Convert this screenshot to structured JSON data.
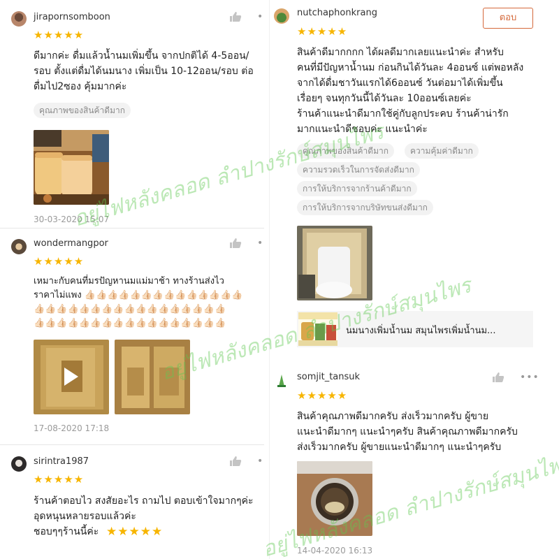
{
  "left_reviews": [
    {
      "username": "jirapornsomboon",
      "stars": "★★★★★",
      "text": "ดีมากค่ะ ดื่มแล้วน้ำนมเพิ่มขึ้น จากปกติได้ 4-5ออน/\nรอบ ตั้งแต่ดื่มได้นมนาง เพิ่มเป็น 10-12ออน/รอบ ต่อ\nดื่มไป2ซอง คุ้มมากค่ะ",
      "tags": [
        "คุณภาพของสินค้าดีมาก"
      ],
      "date": "30-03-2020 15:07"
    },
    {
      "username": "wondermangpor",
      "stars": "★★★★★",
      "text": "เหมาะกับคนที่มรปัญหานมแม่มาช้า ทางร้านส่งไว\nราคาไม่แพง 👍🏻👍🏻👍🏻👍🏻👍🏻👍🏻👍🏻👍🏻👍🏻👍🏻👍🏻👍🏻👍🏻👍🏻\n👍🏻👍🏻👍🏻👍🏻👍🏻👍🏻👍🏻👍🏻👍🏻👍🏻👍🏻👍🏻👍🏻👍🏻👍🏻👍🏻👍🏻\n👍🏻👍🏻👍🏻👍🏻👍🏻👍🏻👍🏻👍🏻👍🏻👍🏻👍🏻👍🏻👍🏻👍🏻👍🏻👍🏻👍🏻",
      "date": "17-08-2020 17:18"
    },
    {
      "username": "sirintra1987",
      "stars": "★★★★★",
      "text": "ร้านค้าตอบไว สงสัยอะไร ถามไป ตอบเข้าใจมากๆค่ะ\nอุดหนุนหลายรอบแล้วค่ะ\nชอบๆๆร้านนี้ค่ะ",
      "inline_stars": "★★★★★"
    }
  ],
  "right_reviews": [
    {
      "username": "nutchaphonkrang",
      "reply_label": "ตอบ",
      "stars": "★★★★★",
      "text": "สินค้าดีมากกกก ได้ผลดีมากเลยแนะนำค่ะ สำหรับ\nคนที่มีปัญหาน้ำนม ก่อนกินได้วันละ 4ออนซ์ แต่พอหลัง\nจากได้ดื่มชาวันแรกได้6ออนซ์ วันต่อมาได้เพิ่มขึ้น\nเรื่อยๆ จนทุกวันนี้ได้วันละ 10ออนซ์เลยค่ะ\nร้านค้าแนะนำดีมากใช้คู่กับลูกประคบ ร้านค้าน่ารัก\nมากแนะนำดีชอบค่ะ แนะนำค่ะ",
      "tags": [
        "คุณภาพของสินค้าดีมาก",
        "ความคุ้มค่าดีมาก",
        "ความรวดเร็วในการจัดส่งดีมาก",
        "การให้บริการจากร้านค้าดีมาก",
        "การให้บริการจากบริษัทขนส่งดีมาก"
      ],
      "product_title": "นมนางเพิ่มน้ำนม สมุนไพรเพิ่มน้ำนม...",
      "product_thumb_text": "นมนางเพิ่มน้ำนม"
    },
    {
      "username": "somjit_tansuk",
      "stars": "★★★★★",
      "text": "สินค้าคุณภาพดีมากครับ ส่งเร็วมากครับ ผู้ขาย\nแนะนำดีมากๆ แนะนำๆครับ สินค้าคุณภาพดีมากครับ\nส่งเร็วมากครับ ผู้ขายแนะนำดีมากๆ แนะนำๆครับ",
      "date": "14-04-2020 16:13"
    }
  ],
  "watermark": "อยู่ไฟหลังคลอด ลำปางรักษ์สมุนไพร",
  "colors": {
    "star": "#f7b500",
    "reply": "#d4683a",
    "watermark": "#5fc850"
  },
  "icons": {
    "like": "thumbs-up-icon",
    "more": "more-dots-icon",
    "play": "play-icon"
  }
}
